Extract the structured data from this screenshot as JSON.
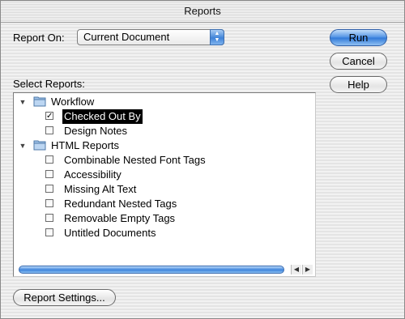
{
  "window": {
    "title": "Reports"
  },
  "report_on": {
    "label": "Report On:",
    "selected": "Current Document"
  },
  "buttons": {
    "run": "Run",
    "cancel": "Cancel",
    "help": "Help",
    "report_settings": "Report Settings..."
  },
  "select_reports": {
    "label": "Select Reports:"
  },
  "tree": {
    "workflow": {
      "label": "Workflow",
      "items": [
        {
          "label": "Checked Out By",
          "checked": true,
          "selected": true
        },
        {
          "label": "Design Notes",
          "checked": false
        }
      ]
    },
    "html_reports": {
      "label": "HTML Reports",
      "items": [
        {
          "label": "Combinable Nested Font Tags",
          "checked": false
        },
        {
          "label": "Accessibility",
          "checked": false
        },
        {
          "label": "Missing Alt Text",
          "checked": false
        },
        {
          "label": "Redundant Nested Tags",
          "checked": false
        },
        {
          "label": "Removable Empty Tags",
          "checked": false
        },
        {
          "label": "Untitled Documents",
          "checked": false
        }
      ]
    }
  },
  "icons": {
    "expand": "disclosure-triangle-open-icon",
    "folder": "folder-icon",
    "checkbox_mark": "✓",
    "popup_arrows": "up-down-arrows-icon"
  },
  "colors": {
    "accent": "#3f83d8",
    "selection": "#000000"
  }
}
